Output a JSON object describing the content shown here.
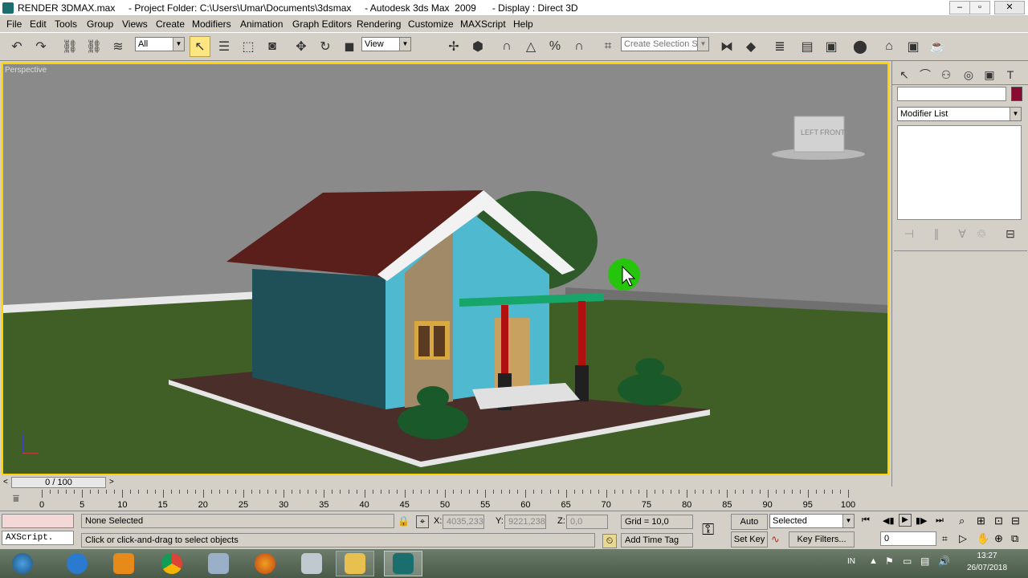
{
  "window": {
    "title": "RENDER 3DMAX.max     - Project Folder: C:\\Users\\Umar\\Documents\\3dsmax     - Autodesk 3ds Max  2009      - Display : Direct 3D",
    "controls": [
      "–",
      "▫",
      "✕"
    ]
  },
  "menu": [
    "File",
    "Edit",
    "Tools",
    "Group",
    "Views",
    "Create",
    "Modifiers",
    "Animation",
    "Graph Editors",
    "Rendering",
    "Customize",
    "MAXScript",
    "Help"
  ],
  "toolbar": {
    "filter_value": "All",
    "coord_value": "View",
    "selection_set_placeholder": "Create Selection Set"
  },
  "viewport": {
    "label": "Perspective",
    "viewcube_left": "LEFT",
    "viewcube_front": "FRONT",
    "axis_label": "z"
  },
  "command_panel": {
    "modifier_list_label": "Modifier List",
    "name_value": "",
    "color_swatch": "#8b0a32"
  },
  "timeline": {
    "frame_display": "0 / 100",
    "ruler_labels": [
      "0",
      "5",
      "10",
      "15",
      "20",
      "25",
      "30",
      "35",
      "40",
      "45",
      "50",
      "55",
      "60",
      "65",
      "70",
      "75",
      "80",
      "85",
      "90",
      "95",
      "100"
    ]
  },
  "status": {
    "maxscript_label": "AXScript.",
    "selection_status": "None Selected",
    "prompt": "Click or click-and-drag to select objects",
    "x_label": "X:",
    "x_value": "4035,233",
    "y_label": "Y:",
    "y_value": "9221,238",
    "z_label": "Z:",
    "z_value": "0,0",
    "grid": "Grid = 10,0",
    "add_time_tag": "Add Time Tag",
    "auto_key": "Auto Key",
    "set_key": "Set Key",
    "key_mode_value": "Selected",
    "key_filters": "Key Filters...",
    "frame_value": "0"
  },
  "taskbar": {
    "language": "IN",
    "time": "13:27",
    "date": "26/07/2018"
  },
  "colors": {
    "viewport_border": "#ffd200",
    "sky": "#8a8a8a",
    "ground": "#3f5f27",
    "cursor_highlight": "#27c40e"
  }
}
